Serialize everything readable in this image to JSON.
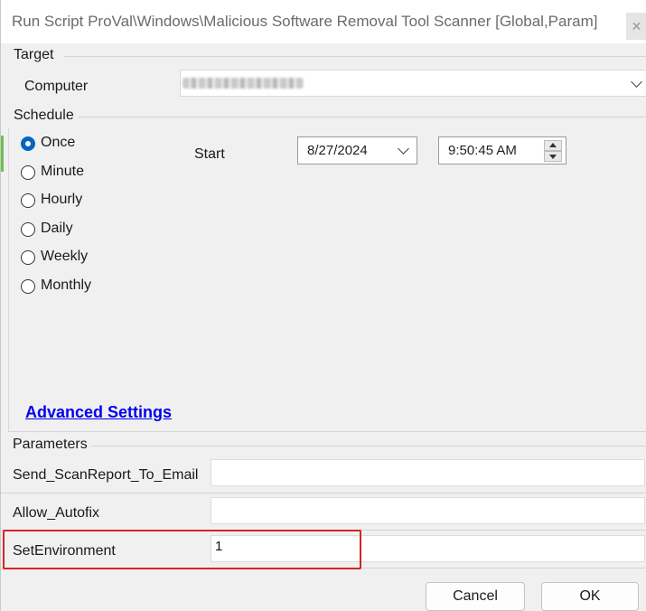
{
  "window": {
    "title": "Run Script ProVal\\Windows\\Malicious Software Removal Tool Scanner [Global,Param]",
    "close_glyph": "✕"
  },
  "target": {
    "section_label": "Target",
    "computer_label": "Computer",
    "computer_value": ""
  },
  "schedule": {
    "section_label": "Schedule",
    "options": [
      "Once",
      "Minute",
      "Hourly",
      "Daily",
      "Weekly",
      "Monthly"
    ],
    "selected": "Once",
    "start_label": "Start",
    "start_date": "8/27/2024",
    "start_time": "9:50:45 AM"
  },
  "advanced_settings_label": "Advanced Settings",
  "parameters": {
    "section_label": "Parameters",
    "rows": [
      {
        "name": "Send_ScanReport_To_Email",
        "value": ""
      },
      {
        "name": "Allow_Autofix",
        "value": ""
      },
      {
        "name": "SetEnvironment",
        "value": "1"
      }
    ]
  },
  "buttons": {
    "cancel": "Cancel",
    "ok": "OK"
  },
  "colors": {
    "accent": "#0067c0",
    "link": "#0000ee",
    "highlight": "#d32424"
  }
}
